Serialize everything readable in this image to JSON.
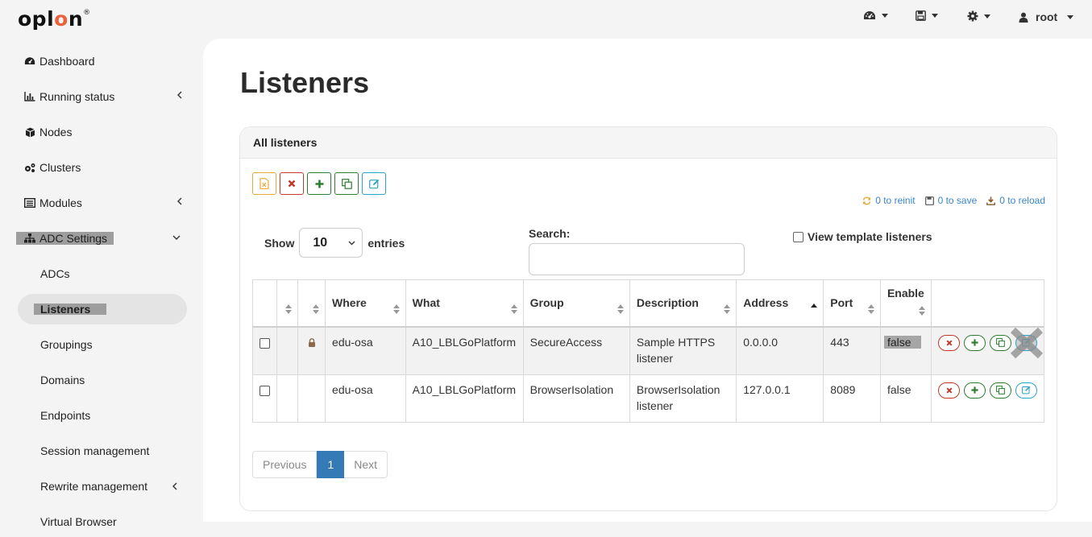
{
  "brand": {
    "logo_text_a": "opl",
    "logo_text_o": "o",
    "logo_text_b": "n",
    "logo_mark": "®"
  },
  "topnav": {
    "user": "root",
    "dashboard_icon": "dashboard-icon",
    "save_icon": "floppy-icon",
    "settings_icon": "gear-icon",
    "user_icon": "user-icon"
  },
  "sidebar": {
    "items": [
      {
        "label": "Dashboard",
        "icon": "dashboard-icon"
      },
      {
        "label": "Running status",
        "icon": "bar-chart-icon"
      },
      {
        "label": "Nodes",
        "icon": "cube-icon"
      },
      {
        "label": "Clusters",
        "icon": "gears-icon"
      },
      {
        "label": "Modules",
        "icon": "list-icon"
      },
      {
        "label": "ADC Settings",
        "icon": "sitemap-icon"
      }
    ],
    "sub_items": [
      "ADCs",
      "Listeners",
      "Groupings",
      "Domains",
      "Endpoints",
      "Session management",
      "Rewrite management",
      "Virtual Browser"
    ]
  },
  "page": {
    "title": "Listeners"
  },
  "card": {
    "title": "All listeners"
  },
  "status": {
    "reinit": "0 to reinit",
    "save": "0 to save",
    "reload": "0 to reload"
  },
  "controls": {
    "show_label": "Show",
    "entries_value": "10",
    "entries_label": "entries",
    "search_label": "Search:",
    "template_label": "View template listeners"
  },
  "table": {
    "columns": [
      "Where",
      "What",
      "Group",
      "Description",
      "Address",
      "Port",
      "Enable"
    ],
    "rows": [
      {
        "where": "edu-osa",
        "what": "A10_LBLGoPlatform",
        "group": "SecureAccess",
        "description": "Sample HTTPS listener",
        "address": "0.0.0.0",
        "port": "443",
        "enable": "false",
        "locked": true
      },
      {
        "where": "edu-osa",
        "what": "A10_LBLGoPlatform",
        "group": "BrowserIsolation",
        "description": "BrowserIsolation listener",
        "address": "127.0.0.1",
        "port": "8089",
        "enable": "false",
        "locked": false
      }
    ]
  },
  "pagination": {
    "previous": "Previous",
    "current": "1",
    "next": "Next"
  },
  "colors": {
    "accent": "#337ab7",
    "brand_o": "#e8623a",
    "delete": "#c0392b",
    "add": "#2e7d32",
    "edit": "#2aa2c9",
    "export": "#e7a93b"
  }
}
